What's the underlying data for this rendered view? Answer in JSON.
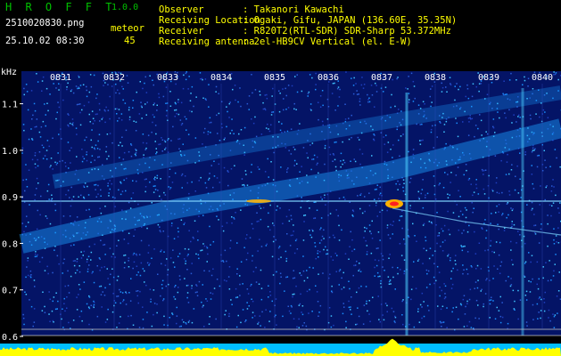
{
  "header": {
    "app_name": "H R O F F T",
    "version": "1.0.0",
    "filename": "2510020830.png",
    "datetime": "25.10.02 08:30",
    "meteor_label": "meteor",
    "meteor_count": "45",
    "info": [
      {
        "key": "Observer",
        "value": ": Takanori Kawachi"
      },
      {
        "key": "Receiving Location",
        "value": ": Ogaki, Gifu, JAPAN (136.60E, 35.35N)"
      },
      {
        "key": "Receiver",
        "value": ": R820T2(RTL-SDR) SDR-Sharp 53.372MHz"
      },
      {
        "key": "Receiving antenna",
        "value": ": 2el-HB9CV Vertical (el. E-W)"
      }
    ]
  },
  "axis": {
    "unit": "kHz",
    "y_ticks": [
      {
        "label": "1.1",
        "value": 1.1
      },
      {
        "label": "1.0",
        "value": 1.0
      },
      {
        "label": "0.9",
        "value": 0.9
      },
      {
        "label": "0.8",
        "value": 0.8
      },
      {
        "label": "0.7",
        "value": 0.7
      },
      {
        "label": "0.6",
        "value": 0.6
      }
    ],
    "time_ticks": [
      "0831",
      "0832",
      "0833",
      "0834",
      "0835",
      "0836",
      "0837",
      "0838",
      "0839",
      "0840"
    ]
  },
  "colors": {
    "background": "#000000",
    "text": "#ffffff",
    "labels": "#ffff00",
    "title": "#00c000",
    "noise": "#0a1a8c",
    "signal": "#4dd0ff",
    "meter": "#ffff00",
    "meter_base": "#00bfff"
  }
}
